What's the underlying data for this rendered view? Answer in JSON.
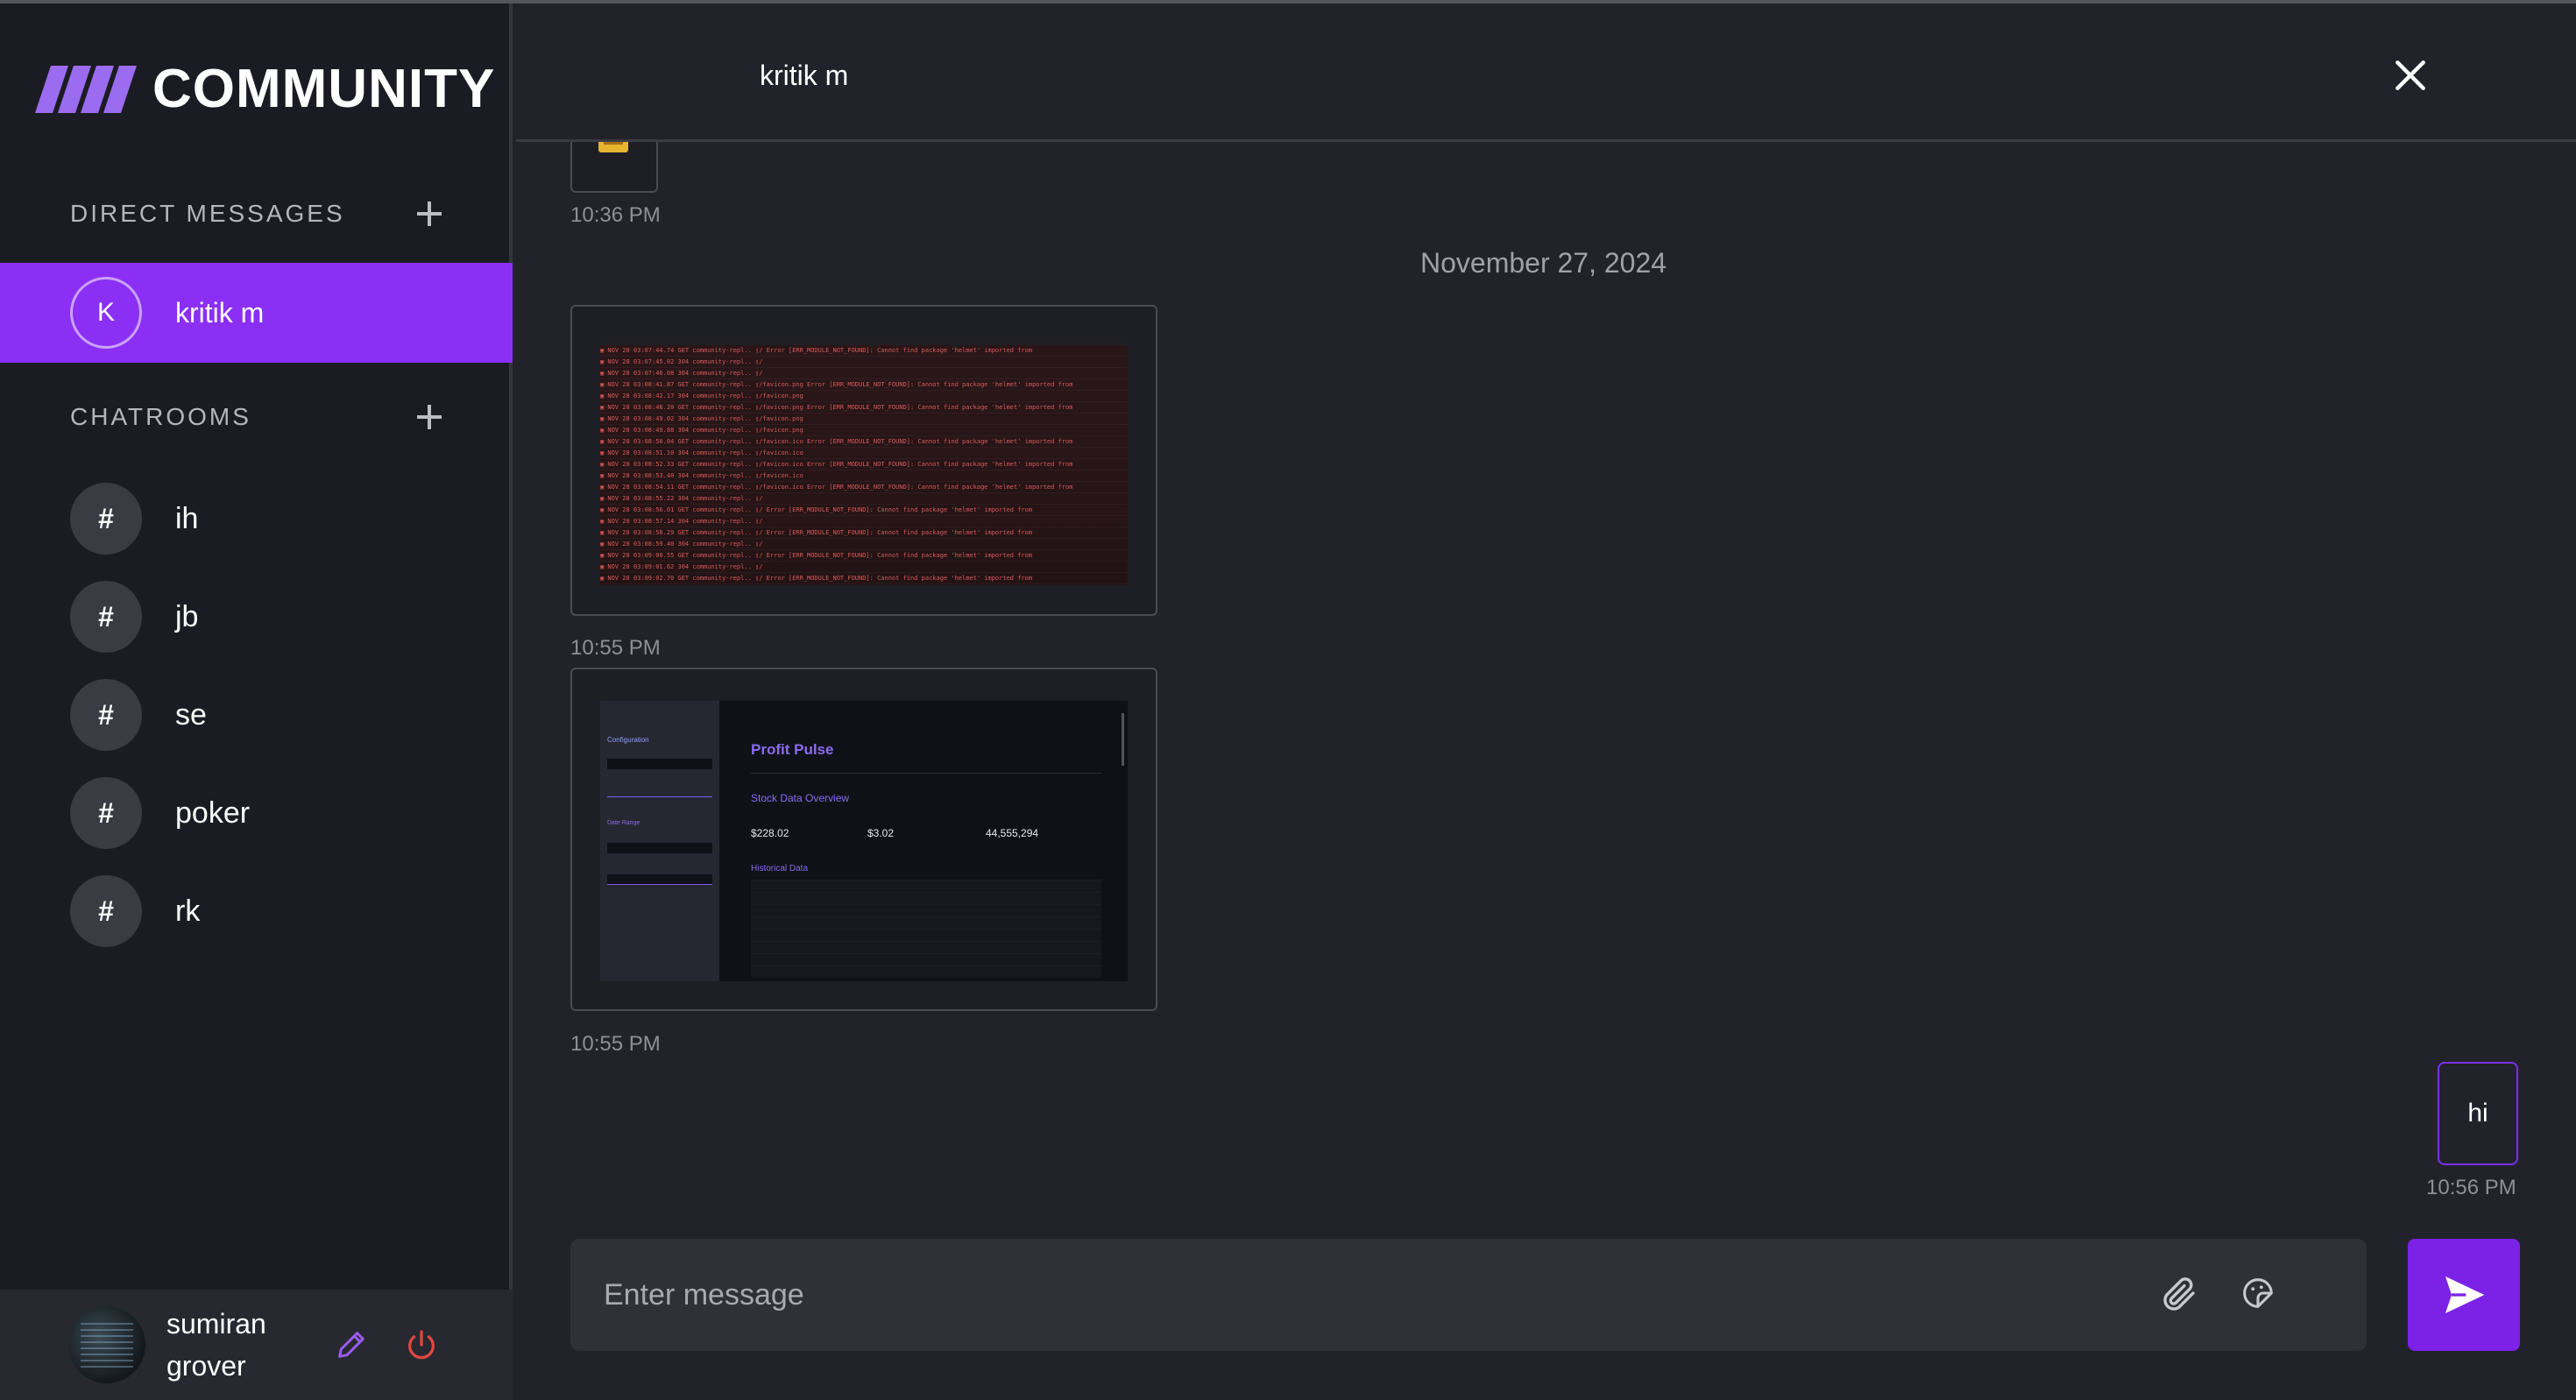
{
  "app": {
    "logo_text": "COMMUNITY",
    "accent_color": "#8b2ff5"
  },
  "sidebar": {
    "direct_messages_title": "DIRECT MESSAGES",
    "chatrooms_title": "CHATROOMS",
    "dms": [
      {
        "initial": "K",
        "name": "kritik m",
        "active": true
      }
    ],
    "chatrooms": [
      {
        "symbol": "#",
        "name": "ih"
      },
      {
        "symbol": "#",
        "name": "jb"
      },
      {
        "symbol": "#",
        "name": "se"
      },
      {
        "symbol": "#",
        "name": "poker"
      },
      {
        "symbol": "#",
        "name": "rk"
      }
    ]
  },
  "user": {
    "first_name": "sumiran",
    "last_name": "grover"
  },
  "chat": {
    "title": "kritik m",
    "date_separator": "November 27, 2024",
    "messages": [
      {
        "type": "image",
        "time": "10:36 PM"
      },
      {
        "type": "image",
        "time": "10:55 PM"
      },
      {
        "type": "image",
        "time": "10:55 PM"
      },
      {
        "type": "text",
        "text": "hi",
        "time": "10:56 PM"
      }
    ],
    "screenshot": {
      "app_title": "Profit Pulse",
      "sidebar_heading": "Configuration",
      "date_range_label": "Date Range",
      "overview_heading": "Stock Data Overview",
      "current_price": "$228.02",
      "daily_change": "$3.02",
      "trading_volume": "44,555,294",
      "historical_heading": "Historical Data"
    }
  },
  "composer": {
    "placeholder": "Enter message"
  }
}
